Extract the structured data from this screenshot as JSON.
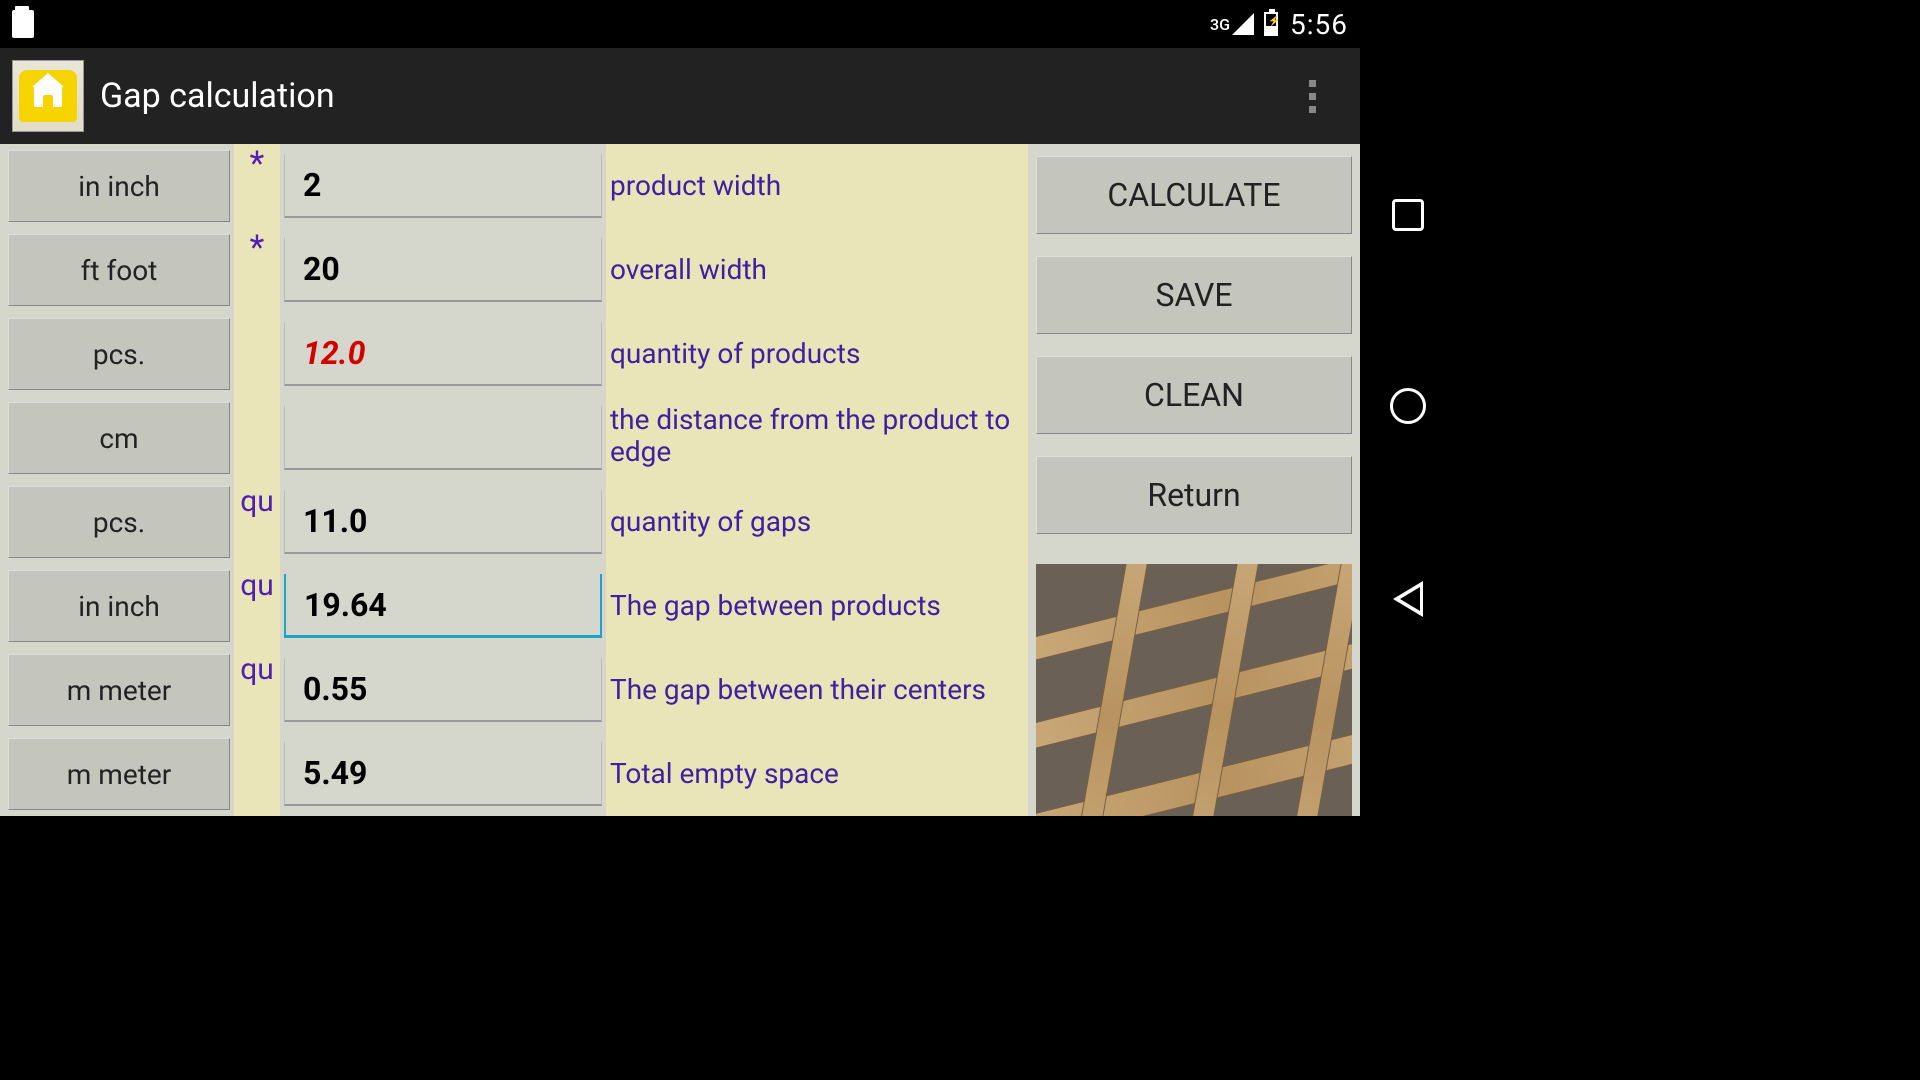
{
  "status": {
    "network": "3G",
    "time": "5:56"
  },
  "header": {
    "title": "Gap calculation"
  },
  "rows": [
    {
      "unit": "in inch",
      "marker": "*",
      "value": "2",
      "label": "product width"
    },
    {
      "unit": "ft foot",
      "marker": "*",
      "value": "20",
      "label": "overall width"
    },
    {
      "unit": "pcs.",
      "marker": "",
      "value": "12.0",
      "label": "quantity of products"
    },
    {
      "unit": "cm",
      "marker": "",
      "value": "",
      "label": "the distance from the product to edge"
    },
    {
      "unit": "pcs.",
      "marker": "qu",
      "value": "11.0",
      "label": "quantity of gaps"
    },
    {
      "unit": "in inch",
      "marker": "qu",
      "value": "19.64",
      "label": "The gap between products"
    },
    {
      "unit": "m meter",
      "marker": "qu",
      "value": "0.55",
      "label": "The gap between their centers"
    },
    {
      "unit": "m meter",
      "marker": "",
      "value": "5.49",
      "label": "Total empty space"
    }
  ],
  "actions": {
    "calculate": "CALCULATE",
    "save": "SAVE",
    "clean": "CLEAN",
    "return": "Return"
  }
}
